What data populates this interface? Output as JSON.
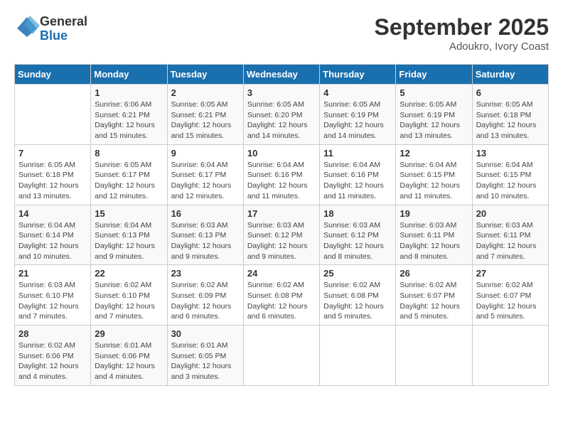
{
  "logo": {
    "line1": "General",
    "line2": "Blue"
  },
  "title": "September 2025",
  "subtitle": "Adoukro, Ivory Coast",
  "days_of_week": [
    "Sunday",
    "Monday",
    "Tuesday",
    "Wednesday",
    "Thursday",
    "Friday",
    "Saturday"
  ],
  "weeks": [
    [
      {
        "day": "",
        "info": ""
      },
      {
        "day": "1",
        "info": "Sunrise: 6:06 AM\nSunset: 6:21 PM\nDaylight: 12 hours\nand 15 minutes."
      },
      {
        "day": "2",
        "info": "Sunrise: 6:05 AM\nSunset: 6:21 PM\nDaylight: 12 hours\nand 15 minutes."
      },
      {
        "day": "3",
        "info": "Sunrise: 6:05 AM\nSunset: 6:20 PM\nDaylight: 12 hours\nand 14 minutes."
      },
      {
        "day": "4",
        "info": "Sunrise: 6:05 AM\nSunset: 6:19 PM\nDaylight: 12 hours\nand 14 minutes."
      },
      {
        "day": "5",
        "info": "Sunrise: 6:05 AM\nSunset: 6:19 PM\nDaylight: 12 hours\nand 13 minutes."
      },
      {
        "day": "6",
        "info": "Sunrise: 6:05 AM\nSunset: 6:18 PM\nDaylight: 12 hours\nand 13 minutes."
      }
    ],
    [
      {
        "day": "7",
        "info": "Sunrise: 6:05 AM\nSunset: 6:18 PM\nDaylight: 12 hours\nand 13 minutes."
      },
      {
        "day": "8",
        "info": "Sunrise: 6:05 AM\nSunset: 6:17 PM\nDaylight: 12 hours\nand 12 minutes."
      },
      {
        "day": "9",
        "info": "Sunrise: 6:04 AM\nSunset: 6:17 PM\nDaylight: 12 hours\nand 12 minutes."
      },
      {
        "day": "10",
        "info": "Sunrise: 6:04 AM\nSunset: 6:16 PM\nDaylight: 12 hours\nand 11 minutes."
      },
      {
        "day": "11",
        "info": "Sunrise: 6:04 AM\nSunset: 6:16 PM\nDaylight: 12 hours\nand 11 minutes."
      },
      {
        "day": "12",
        "info": "Sunrise: 6:04 AM\nSunset: 6:15 PM\nDaylight: 12 hours\nand 11 minutes."
      },
      {
        "day": "13",
        "info": "Sunrise: 6:04 AM\nSunset: 6:15 PM\nDaylight: 12 hours\nand 10 minutes."
      }
    ],
    [
      {
        "day": "14",
        "info": "Sunrise: 6:04 AM\nSunset: 6:14 PM\nDaylight: 12 hours\nand 10 minutes."
      },
      {
        "day": "15",
        "info": "Sunrise: 6:04 AM\nSunset: 6:13 PM\nDaylight: 12 hours\nand 9 minutes."
      },
      {
        "day": "16",
        "info": "Sunrise: 6:03 AM\nSunset: 6:13 PM\nDaylight: 12 hours\nand 9 minutes."
      },
      {
        "day": "17",
        "info": "Sunrise: 6:03 AM\nSunset: 6:12 PM\nDaylight: 12 hours\nand 9 minutes."
      },
      {
        "day": "18",
        "info": "Sunrise: 6:03 AM\nSunset: 6:12 PM\nDaylight: 12 hours\nand 8 minutes."
      },
      {
        "day": "19",
        "info": "Sunrise: 6:03 AM\nSunset: 6:11 PM\nDaylight: 12 hours\nand 8 minutes."
      },
      {
        "day": "20",
        "info": "Sunrise: 6:03 AM\nSunset: 6:11 PM\nDaylight: 12 hours\nand 7 minutes."
      }
    ],
    [
      {
        "day": "21",
        "info": "Sunrise: 6:03 AM\nSunset: 6:10 PM\nDaylight: 12 hours\nand 7 minutes."
      },
      {
        "day": "22",
        "info": "Sunrise: 6:02 AM\nSunset: 6:10 PM\nDaylight: 12 hours\nand 7 minutes."
      },
      {
        "day": "23",
        "info": "Sunrise: 6:02 AM\nSunset: 6:09 PM\nDaylight: 12 hours\nand 6 minutes."
      },
      {
        "day": "24",
        "info": "Sunrise: 6:02 AM\nSunset: 6:08 PM\nDaylight: 12 hours\nand 6 minutes."
      },
      {
        "day": "25",
        "info": "Sunrise: 6:02 AM\nSunset: 6:08 PM\nDaylight: 12 hours\nand 5 minutes."
      },
      {
        "day": "26",
        "info": "Sunrise: 6:02 AM\nSunset: 6:07 PM\nDaylight: 12 hours\nand 5 minutes."
      },
      {
        "day": "27",
        "info": "Sunrise: 6:02 AM\nSunset: 6:07 PM\nDaylight: 12 hours\nand 5 minutes."
      }
    ],
    [
      {
        "day": "28",
        "info": "Sunrise: 6:02 AM\nSunset: 6:06 PM\nDaylight: 12 hours\nand 4 minutes."
      },
      {
        "day": "29",
        "info": "Sunrise: 6:01 AM\nSunset: 6:06 PM\nDaylight: 12 hours\nand 4 minutes."
      },
      {
        "day": "30",
        "info": "Sunrise: 6:01 AM\nSunset: 6:05 PM\nDaylight: 12 hours\nand 3 minutes."
      },
      {
        "day": "",
        "info": ""
      },
      {
        "day": "",
        "info": ""
      },
      {
        "day": "",
        "info": ""
      },
      {
        "day": "",
        "info": ""
      }
    ]
  ]
}
